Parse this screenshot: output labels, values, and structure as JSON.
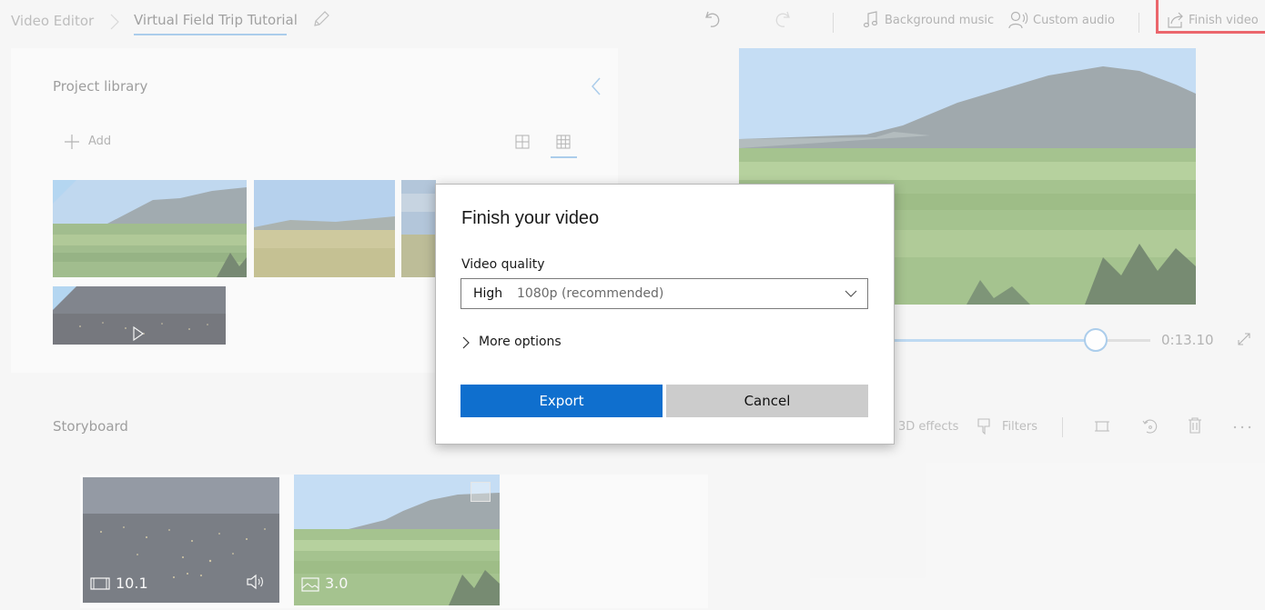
{
  "topbar": {
    "breadcrumb_root": "Video Editor",
    "project_title": "Virtual Field Trip Tutorial",
    "background_music_label": "Background music",
    "custom_audio_label": "Custom audio",
    "finish_video_label": "Finish video",
    "icons": [
      "chevron-right-icon",
      "pencil-icon",
      "undo-icon",
      "redo-icon",
      "music-note-icon",
      "custom-audio-icon",
      "share-export-icon"
    ]
  },
  "library": {
    "title": "Project library",
    "add_label": "Add"
  },
  "preview": {
    "time": "0:13.10",
    "position_fraction": 0.8
  },
  "storyboard": {
    "title": "Storyboard",
    "tools": {
      "effects_label": "3D effects",
      "filters_label": "Filters"
    },
    "cards": [
      {
        "duration": "10.1",
        "kind": "video"
      },
      {
        "duration": "3.0",
        "kind": "image"
      }
    ]
  },
  "dialog": {
    "title": "Finish your video",
    "quality_label": "Video quality",
    "quality_value_strong": "High",
    "quality_value_light": "1080p (recommended)",
    "more_options_label": "More options",
    "export_label": "Export",
    "cancel_label": "Cancel"
  },
  "colors": {
    "accent": "#0f6fce",
    "highlight_border": "#e0141e",
    "selection": "#7fb2e0"
  }
}
